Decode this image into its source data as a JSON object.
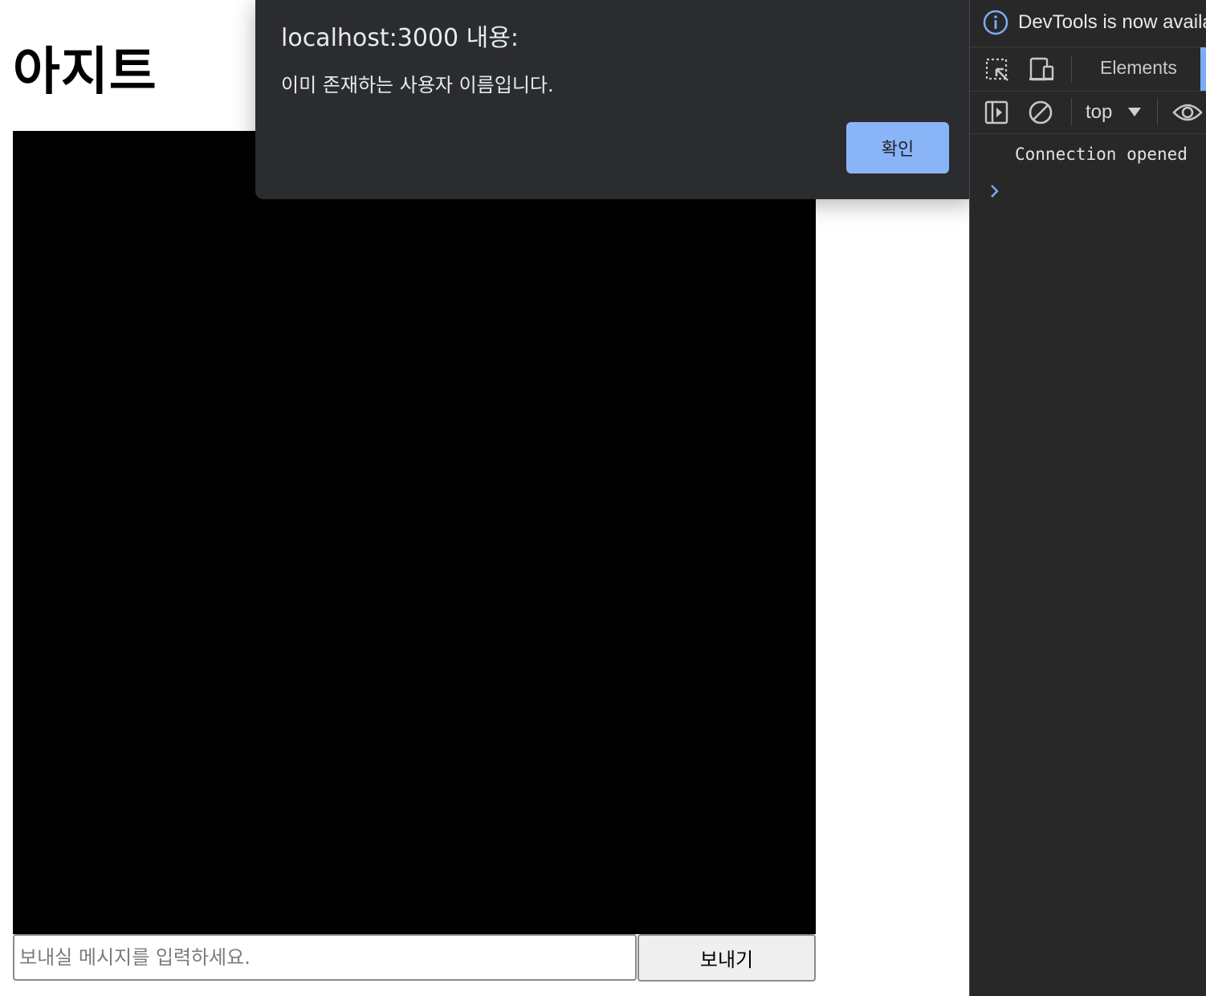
{
  "page": {
    "title": "아지트",
    "message_input": {
      "value": "",
      "placeholder": "보내실 메시지를 입력하세요."
    },
    "send_button_label": "보내기"
  },
  "alert": {
    "title": "localhost:3000 내용:",
    "message": "이미 존재하는 사용자 이름입니다.",
    "ok_label": "확인"
  },
  "devtools": {
    "info_text": "DevTools is now available",
    "tabs": {
      "elements": "Elements"
    },
    "context_selector": "top",
    "console_lines": [
      "Connection opened"
    ]
  },
  "colors": {
    "accent": "#8ab4f8",
    "devtools_bg": "#282828",
    "alert_bg": "#2b2c2f",
    "chat_area": "#000000"
  },
  "icons": {
    "info": "info-icon",
    "inspect": "inspect-element-icon",
    "device": "device-toolbar-icon",
    "sidebar": "console-sidebar-icon",
    "clear": "clear-console-icon",
    "eye": "live-expression-eye-icon",
    "prompt": "console-prompt-chevron-icon"
  }
}
